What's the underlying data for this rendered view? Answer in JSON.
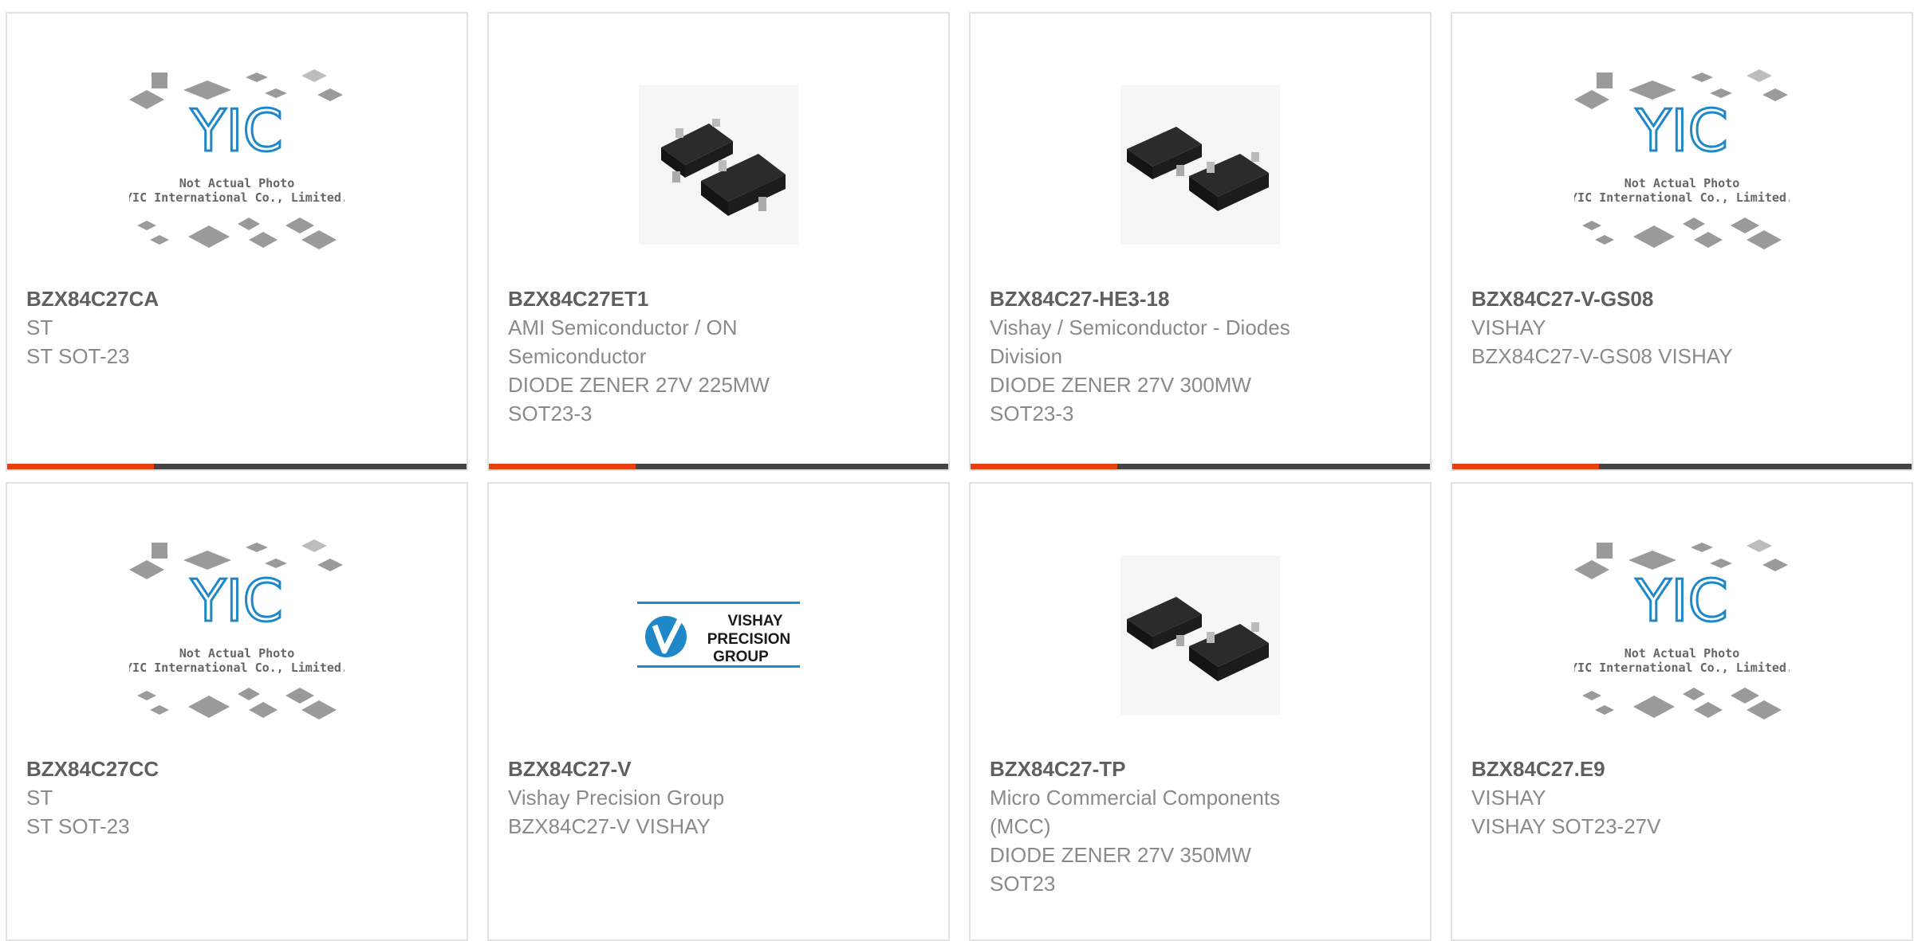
{
  "placeholder": {
    "line1": "Not Actual Photo",
    "line2": "YIC International Co., Limited.",
    "logo": "YIC"
  },
  "vpg_logo": {
    "line1": "VISHAY",
    "line2": "PRECISION",
    "line3": "GROUP"
  },
  "colors": {
    "accent": "#e8410f",
    "bar": "#444444",
    "brand_blue": "#1e88c8"
  },
  "products": [
    {
      "part": "BZX84C27CA",
      "lines": [
        "ST",
        "ST SOT-23"
      ],
      "image": "placeholder",
      "progress": 0.32
    },
    {
      "part": "BZX84C27ET1",
      "lines": [
        "AMI Semiconductor / ON",
        "Semiconductor",
        "DIODE ZENER 27V 225MW",
        "SOT23-3"
      ],
      "image": "sot23-chip",
      "progress": 0.32
    },
    {
      "part": "BZX84C27-HE3-18",
      "lines": [
        "Vishay / Semiconductor - Diodes",
        "Division",
        "DIODE ZENER 27V 300MW",
        "SOT23-3"
      ],
      "image": "sot23-chip",
      "progress": 0.32
    },
    {
      "part": "BZX84C27-V-GS08",
      "lines": [
        "VISHAY",
        "BZX84C27-V-GS08 VISHAY"
      ],
      "image": "placeholder",
      "progress": 0.32
    },
    {
      "part": "BZX84C27CC",
      "lines": [
        "ST",
        "ST SOT-23"
      ],
      "image": "placeholder"
    },
    {
      "part": "BZX84C27-V",
      "lines": [
        "Vishay Precision Group",
        "BZX84C27-V VISHAY"
      ],
      "image": "vpg-logo"
    },
    {
      "part": "BZX84C27-TP",
      "lines": [
        "Micro Commercial Components",
        "(MCC)",
        "DIODE ZENER 27V 350MW",
        "SOT23"
      ],
      "image": "sot23-chip"
    },
    {
      "part": "BZX84C27.E9",
      "lines": [
        "VISHAY",
        "VISHAY SOT23-27V"
      ],
      "image": "placeholder"
    }
  ]
}
